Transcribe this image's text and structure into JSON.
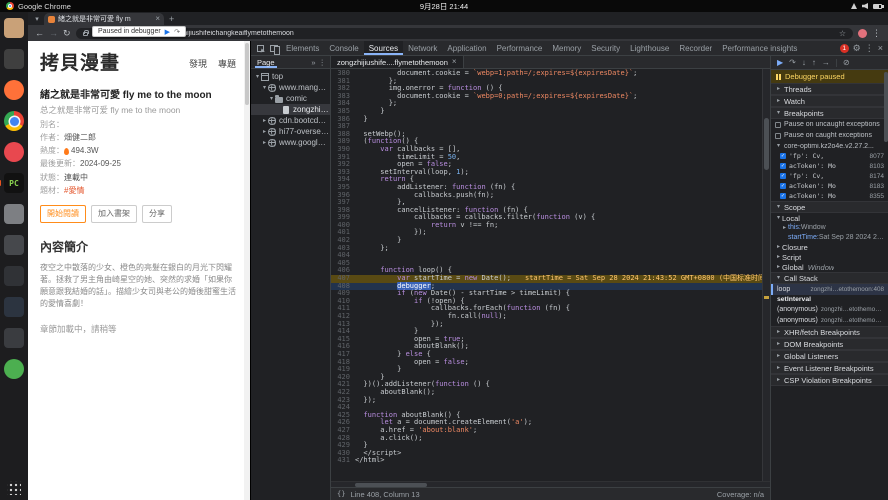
{
  "system": {
    "app_name": "Google Chrome",
    "clock": "9月28日 21:44"
  },
  "icons": {
    "arrow_open": "▾",
    "arrow_closed": "▸",
    "chevron_down": "▾",
    "close": "×",
    "plus": "+",
    "back": "←",
    "forward": "→",
    "reload": "↻",
    "star": "☆",
    "more": "⋮",
    "settings": "⚙",
    "overflow": "»",
    "resume": "▶",
    "step_over": "↷",
    "step_into": "↓",
    "step_out": "↑",
    "step": "→",
    "deactivate": "⊘",
    "pretty_print": "{}",
    "error_count": "1",
    "check": "✓"
  },
  "dock": {
    "items": [
      {
        "name": "files",
        "color": "#c9a178"
      },
      {
        "name": "archive-manager",
        "color": "#3f3f3f"
      },
      {
        "name": "firefox",
        "color": "#ff7139",
        "shape": "circle"
      },
      {
        "name": "chrome",
        "shape": "chrome"
      },
      {
        "name": "media-player",
        "color": "#e8484f",
        "shape": "circle"
      },
      {
        "name": "pc-terminal",
        "color": "#111111",
        "label": "PC",
        "running": true
      },
      {
        "name": "app-grey",
        "color": "#7d7f83"
      },
      {
        "name": "app-dark-1",
        "color": "#46484c"
      },
      {
        "name": "app-dark-2",
        "color": "#303236"
      },
      {
        "name": "app-dark-3",
        "color": "#2c3440"
      },
      {
        "name": "app-dark-4",
        "color": "#3a3c40"
      },
      {
        "name": "app-green",
        "color": "#4caf50",
        "shape": "circle"
      }
    ]
  },
  "browser": {
    "tab_title": "緒之就是非常可愛 fly m",
    "url": "mangacopy.com/comic/zongzhijiushifeichangkeaiflymetothemoon",
    "paused_banner": "Paused in debugger"
  },
  "page": {
    "site_title": "拷貝漫畫",
    "nav": [
      "發現",
      "專題"
    ],
    "manga": {
      "title_tc": "緒之就是非常可愛 fly me to the moon",
      "title_sc": "总之就是非常可爱 fly me to the moon",
      "meta": [
        {
          "label": "別名：",
          "value": ""
        },
        {
          "label": "作者：",
          "value": "畑健二郎",
          "kind": "link"
        },
        {
          "label": "熱度：",
          "value": "494.3W",
          "kind": "heat"
        },
        {
          "label": "最後更新：",
          "value": "2024-09-25"
        },
        {
          "label": "狀態：",
          "value": "連載中"
        },
        {
          "label": "題材：",
          "value": "#愛情",
          "kind": "tag"
        }
      ],
      "actions": [
        "開始閱讀",
        "加入書架",
        "分享"
      ]
    },
    "summary": {
      "heading": "內容簡介",
      "text": "夜空之中散落的少女、橙色的亮髮在銀白的月光下閃耀著。拯救了男主角由崎星空的她、突然的求婚「如果你願意跟我結婚的話」。描繪少女司與老公的婚後甜蜜生活的愛情喜劇！",
      "loading": "章節加載中，請稍等"
    }
  },
  "devtools": {
    "tabs": [
      "Elements",
      "Console",
      "Sources",
      "Network",
      "Application",
      "Performance",
      "Memory",
      "Security",
      "Lighthouse",
      "Recorder",
      "Performance insights"
    ],
    "active_tab": "Sources",
    "navigator": {
      "tab_label": "Page",
      "tree": [
        {
          "label": "top",
          "depth": 0,
          "icon": "frame",
          "expand": "open"
        },
        {
          "label": "www.mangacopy....",
          "depth": 1,
          "icon": "globe",
          "expand": "open"
        },
        {
          "label": "comic",
          "depth": 2,
          "icon": "folder",
          "expand": "open"
        },
        {
          "label": "zongzhijiushif...",
          "depth": 3,
          "icon": "file",
          "selected": true
        },
        {
          "label": "cdn.bootcdn.net",
          "depth": 1,
          "icon": "globe",
          "expand": "closed"
        },
        {
          "label": "hi77-overseas.ma...",
          "depth": 1,
          "icon": "globe",
          "expand": "closed"
        },
        {
          "label": "www.googletagm...",
          "depth": 1,
          "icon": "globe",
          "expand": "closed"
        }
      ]
    },
    "editor": {
      "file_tab": "zongzhijiushife....flymetothemoon",
      "status_line": "Line 408, Column 13",
      "coverage": "Coverage: n/a",
      "lines": [
        {
          "n": 380,
          "t": "          document.cookie = `webp=1;path=/;expires=${expiresDate}`;"
        },
        {
          "n": 381,
          "t": "        };"
        },
        {
          "n": 382,
          "t": "        img.onerror = function () {"
        },
        {
          "n": 383,
          "t": "          document.cookie = `webp=0;path=/;expires=${expiresDate}`;"
        },
        {
          "n": 384,
          "t": "        };"
        },
        {
          "n": 385,
          "t": "      }"
        },
        {
          "n": 386,
          "t": "  }"
        },
        {
          "n": 387,
          "t": ""
        },
        {
          "n": 388,
          "t": "  setWebp();"
        },
        {
          "n": 389,
          "t": "  (function() {"
        },
        {
          "n": 390,
          "t": "      var callbacks = [],"
        },
        {
          "n": 391,
          "t": "          timeLimit = 50,"
        },
        {
          "n": 392,
          "t": "          open = false;"
        },
        {
          "n": 393,
          "t": "      setInterval(loop, 1);"
        },
        {
          "n": 394,
          "t": "      return {"
        },
        {
          "n": 395,
          "t": "          addListener: function (fn) {"
        },
        {
          "n": 396,
          "t": "              callbacks.push(fn);"
        },
        {
          "n": 397,
          "t": "          },"
        },
        {
          "n": 398,
          "t": "          cancelListener: function (fn) {"
        },
        {
          "n": 399,
          "t": "              callbacks = callbacks.filter(function (v) {"
        },
        {
          "n": 400,
          "t": "                  return v !== fn;"
        },
        {
          "n": 401,
          "t": "              });"
        },
        {
          "n": 402,
          "t": "          }"
        },
        {
          "n": 403,
          "t": "      };"
        },
        {
          "n": 404,
          "t": ""
        },
        {
          "n": 405,
          "t": ""
        },
        {
          "n": 406,
          "t": "      function loop() {"
        },
        {
          "n": 407,
          "t": "          var startTime = new Date();",
          "mark": "exec",
          "ann": "startTime = Sat Sep 28 2024 21:43:52 GMT+0800 (中国标准时间)"
        },
        {
          "n": 408,
          "t": "          debugger;",
          "mark": "paused"
        },
        {
          "n": 409,
          "t": "          if (new Date() - startTime > timeLimit) {"
        },
        {
          "n": 410,
          "t": "              if (!open) {"
        },
        {
          "n": 411,
          "t": "                  callbacks.forEach(function (fn) {"
        },
        {
          "n": 412,
          "t": "                      fn.call(null);"
        },
        {
          "n": 413,
          "t": "                  });"
        },
        {
          "n": 414,
          "t": "              }"
        },
        {
          "n": 415,
          "t": "              open = true;"
        },
        {
          "n": 416,
          "t": "              aboutBlank();"
        },
        {
          "n": 417,
          "t": "          } else {"
        },
        {
          "n": 418,
          "t": "              open = false;"
        },
        {
          "n": 419,
          "t": "          }"
        },
        {
          "n": 420,
          "t": "      }"
        },
        {
          "n": 421,
          "t": "  })().addListener(function () {"
        },
        {
          "n": 422,
          "t": "      aboutBlank();"
        },
        {
          "n": 423,
          "t": "  });"
        },
        {
          "n": 424,
          "t": ""
        },
        {
          "n": 425,
          "t": "  function aboutBlank() {"
        },
        {
          "n": 426,
          "t": "      let a = document.createElement('a');"
        },
        {
          "n": 427,
          "t": "      a.href = 'about:blank';"
        },
        {
          "n": 428,
          "t": "      a.click();"
        },
        {
          "n": 429,
          "t": "  }"
        },
        {
          "n": 430,
          "t": "  </script>"
        },
        {
          "n": 431,
          "t": "</html>"
        }
      ]
    },
    "sidebar": {
      "paused_message": "Debugger paused",
      "threads_label": "Threads",
      "watch_label": "Watch",
      "breakpoints": {
        "title": "Breakpoints",
        "toggles": [
          "Pause on uncaught exceptions",
          "Pause on caught exceptions"
        ],
        "file_group": "core-optimi.kz2o4e.v2.27.2...",
        "entries": [
          {
            "snippet": "'fp': Cv,",
            "line": "8077"
          },
          {
            "snippet": "acToken': Mo",
            "line": "8103"
          },
          {
            "snippet": "'fp': Cv,",
            "line": "8174"
          },
          {
            "snippet": "acToken': Mo",
            "line": "8183"
          },
          {
            "snippet": "acToken': Mo",
            "line": "8355"
          }
        ]
      },
      "scope": {
        "title": "Scope",
        "rows": [
          {
            "kind": "group",
            "label": "Local",
            "expand": "open"
          },
          {
            "kind": "prop",
            "name": "this",
            "value": "Window",
            "arrow": true
          },
          {
            "kind": "prop",
            "name": "startTime",
            "value": "Sat Sep 28 2024 21:4…"
          },
          {
            "kind": "group",
            "label": "Closure",
            "expand": "closed"
          },
          {
            "kind": "group",
            "label": "Script",
            "expand": "closed"
          },
          {
            "kind": "group",
            "label": "Global",
            "expand": "closed",
            "value": "Window"
          }
        ]
      },
      "call_stack": {
        "title": "Call Stack",
        "frames": [
          {
            "fn": "loop",
            "loc": "zongzhi…etothemoon:408",
            "active": true
          },
          {
            "separator": "setInterval"
          },
          {
            "fn": "(anonymous)",
            "loc": "zongzhi…etothemoon:393"
          },
          {
            "fn": "(anonymous)",
            "loc": "zongzhi…etothemoon:431"
          }
        ]
      },
      "bottom_sections": [
        "XHR/fetch Breakpoints",
        "DOM Breakpoints",
        "Global Listeners",
        "Event Listener Breakpoints",
        "CSP Violation Breakpoints"
      ]
    }
  }
}
